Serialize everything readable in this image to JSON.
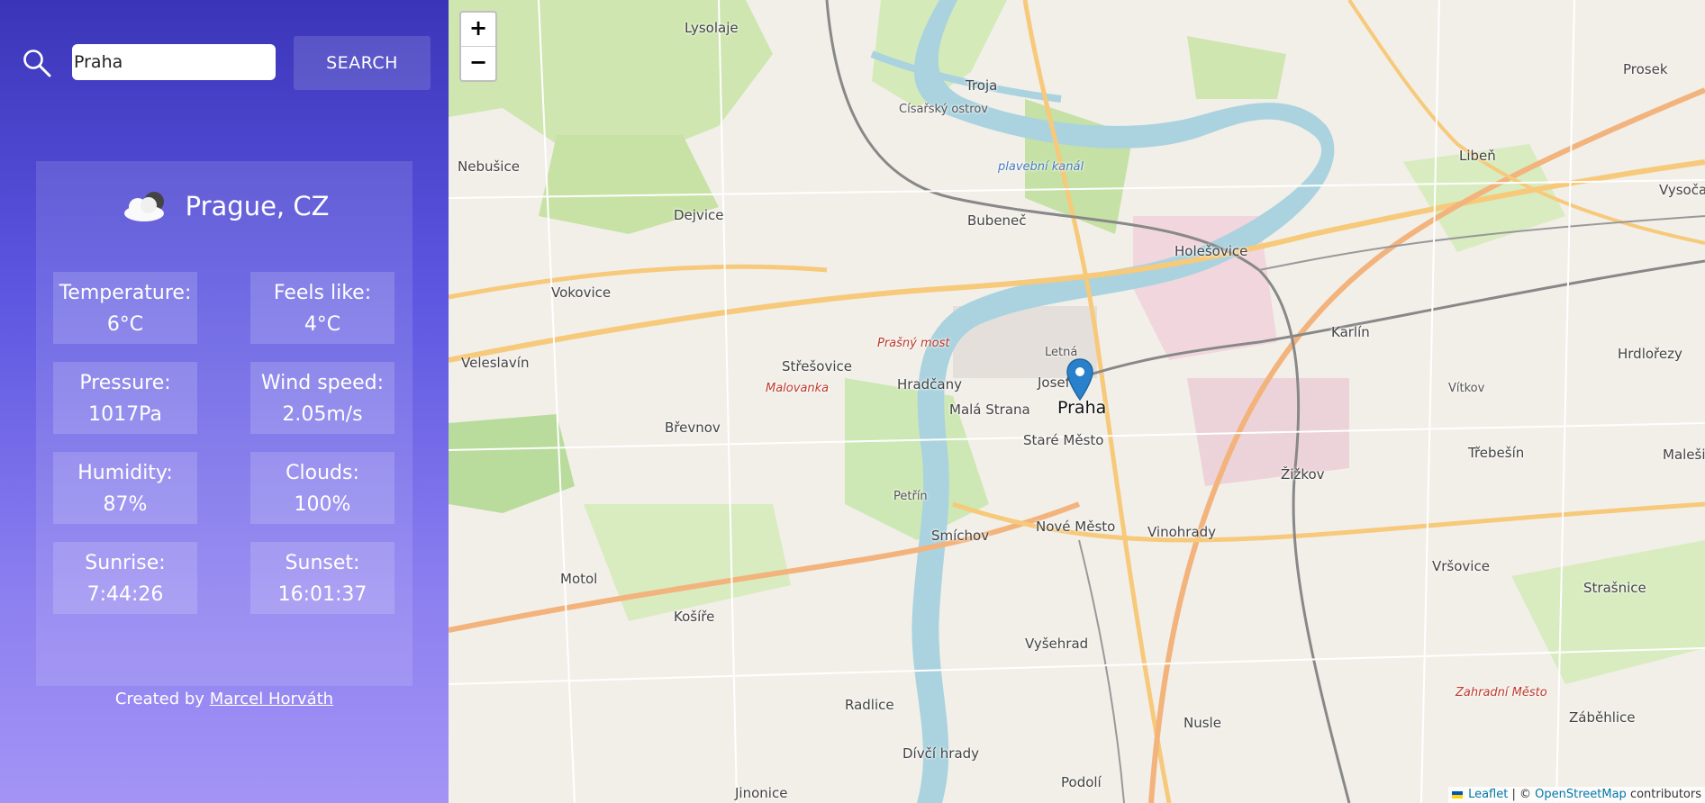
{
  "search": {
    "icon": "search-icon",
    "value": "Praha",
    "button_label": "SEARCH"
  },
  "weather": {
    "icon": "cloudy-icon",
    "city": "Prague, CZ",
    "stats": {
      "temperature": {
        "label": "Temperature:",
        "value": "6°C"
      },
      "feels_like": {
        "label": "Feels like:",
        "value": "4°C"
      },
      "pressure": {
        "label": "Pressure:",
        "value": "1017Pa"
      },
      "wind_speed": {
        "label": "Wind speed:",
        "value": "2.05m/s"
      },
      "humidity": {
        "label": "Humidity:",
        "value": "87%"
      },
      "clouds": {
        "label": "Clouds:",
        "value": "100%"
      },
      "sunrise": {
        "label": "Sunrise:",
        "value": "7:44:26"
      },
      "sunset": {
        "label": "Sunset:",
        "value": "16:01:37"
      }
    }
  },
  "credit": {
    "prefix": "Created by",
    "author": "Marcel Horváth"
  },
  "map": {
    "zoom_in": "+",
    "zoom_out": "−",
    "marker_icon": "map-pin-icon",
    "attribution": {
      "leaflet": "Leaflet",
      "separator": "| ©",
      "osm": "OpenStreetMap",
      "suffix": "contributors"
    },
    "places": {
      "lysolaje": "Lysolaje",
      "troja": "Troja",
      "prosek": "Prosek",
      "liben": "Libeň",
      "vysocany": "Vysočany",
      "nebusice": "Nebušice",
      "dejvice": "Dejvice",
      "bubenec": "Bubeneč",
      "holesovice": "Holešovice",
      "vokovice": "Vokovice",
      "veleslavin": "Veleslavín",
      "karlin": "Karlín",
      "hrdlorezy": "Hrdlořezy",
      "stresovice": "Střešovice",
      "hradcany": "Hradčany",
      "josefov": "Josef",
      "praha": "Praha",
      "mala_strana": "Malá Strana",
      "stare_mesto": "Staré Město",
      "brevnov": "Břevnov",
      "trebesin": "Třebešín",
      "malesice": "Malešic",
      "zizkov": "Žižkov",
      "smichov": "Smíchov",
      "nove_mesto": "Nové Město",
      "vinohrady": "Vinohrady",
      "motol": "Motol",
      "vrsovice": "Vršovice",
      "strasnice": "Strašnice",
      "kosire": "Košíře",
      "vysehrad": "Vyšehrad",
      "radlice": "Radlice",
      "nusle": "Nusle",
      "zabehlice": "Záběhlice",
      "divci_hrady": "Dívčí hrady",
      "podoli": "Podolí",
      "jinonice": "Jinonice",
      "letna": "Letná",
      "petrin": "Petřín",
      "malovanka": "Malovanka",
      "prasny_most": "Prašný most",
      "cisarsky_ostrov": "Císařský ostrov",
      "plavebni_kanal": "plavební kanál",
      "vitkov": "Vítkov",
      "zahradni_mesto": "Zahradní Město"
    }
  }
}
